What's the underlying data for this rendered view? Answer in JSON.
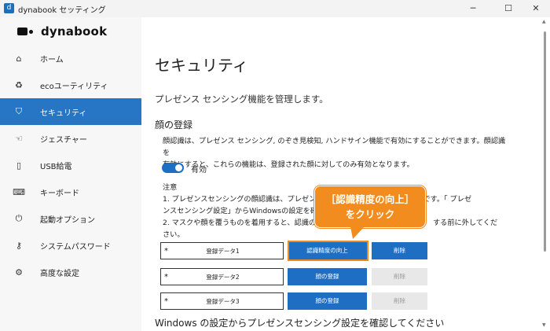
{
  "window": {
    "title": "dynabook セッティング",
    "minimize": "─",
    "maximize": "☐",
    "close": "✕"
  },
  "brand": {
    "name": "dynabook"
  },
  "sidebar": {
    "items": [
      {
        "label": "ホーム",
        "icon": "⌂"
      },
      {
        "label": "ecoユーティリティ",
        "icon": "♻"
      },
      {
        "label": "セキュリティ",
        "icon": "⛉",
        "active": true
      },
      {
        "label": "ジェスチャー",
        "icon": "☜"
      },
      {
        "label": "USB給電",
        "icon": "▯"
      },
      {
        "label": "キーボード",
        "icon": "⌨"
      },
      {
        "label": "起動オプション",
        "icon": "⏻"
      },
      {
        "label": "システムパスワード",
        "icon": "⚷"
      },
      {
        "label": "高度な設定",
        "icon": "⚙"
      }
    ]
  },
  "main": {
    "title": "セキュリティ",
    "subtitle": "プレゼンス センシング機能を管理します。",
    "section_title": "顔の登録",
    "description_1": "顔認識は、プレゼンス センシング, のぞき見検知, ハンドサイン機能で有効にすることができます。顔認識を",
    "description_2": "有効にすると、これらの機能は、登録された顔に対してのみ有効となります。",
    "toggle": {
      "state": "on",
      "label": "有効"
    },
    "note_title": "注意",
    "note_1": "1. プレゼンスセンシングの顔認識は、プレゼンス",
    "note_1b": "可能です。「 プレゼ",
    "note_2": "ンスセンシング設定」からWindowsの設定を確",
    "note_3": "2. マスクや顔を覆うものを着用すると、認識の",
    "note_3b": "する前に外してくだ",
    "note_4": "さい。",
    "registrations": [
      {
        "star": "*",
        "name": "登録データ1",
        "action": "認識精度の向上",
        "delete": "削除",
        "delete_enabled": true
      },
      {
        "star": "*",
        "name": "登録データ2",
        "action": "顔の登録",
        "delete": "削除",
        "delete_enabled": false
      },
      {
        "star": "*",
        "name": "登録データ3",
        "action": "顔の登録",
        "delete": "削除",
        "delete_enabled": false
      }
    ],
    "footer_link": "Windows の設定からプレゼンスセンシング設定を確認してください"
  },
  "callout": {
    "line1": "［認識精度の向上］",
    "line2": "をクリック",
    "color": "#f28c1f"
  },
  "colors": {
    "accent": "#1e6fc4",
    "highlight": "#f08a1c"
  }
}
